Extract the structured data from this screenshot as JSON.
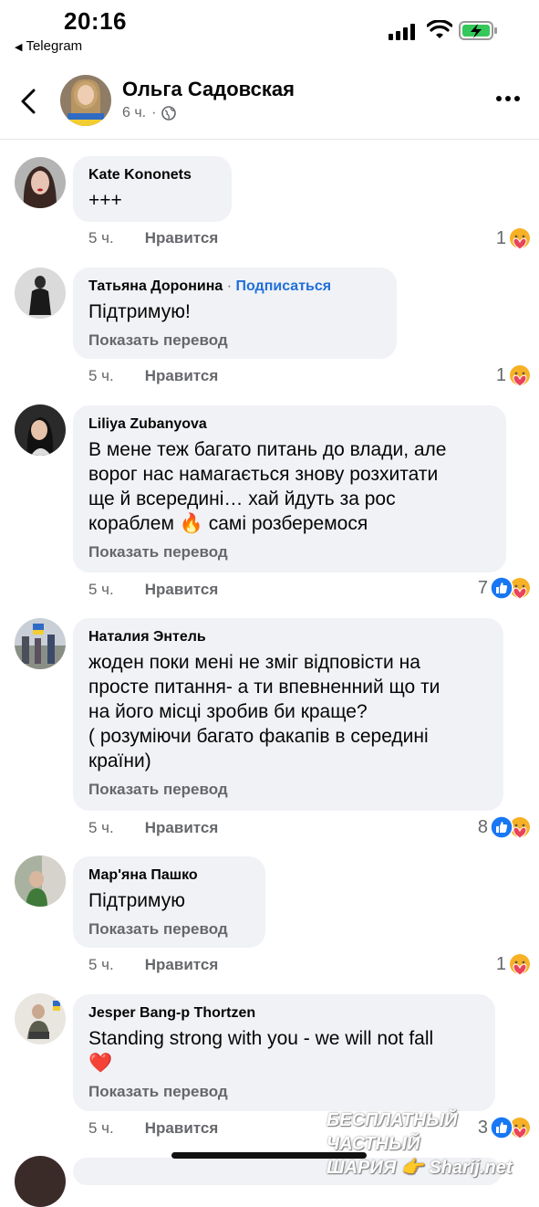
{
  "status_bar": {
    "time": "20:16",
    "back_app": "Telegram"
  },
  "header": {
    "name": "Ольга Садовская",
    "time": "6 ч.",
    "separator": "·"
  },
  "comments": [
    {
      "author": "Kate  Kononets",
      "text": "+++",
      "translate": "",
      "time": "5 ч.",
      "like": "Нравится",
      "count": "1",
      "reactions": [
        "care"
      ]
    },
    {
      "author": "Татьяна Доронина",
      "follow_sep": " · ",
      "follow": "Подписаться",
      "text": "Підтримую!",
      "translate": "Показать перевод",
      "time": "5 ч.",
      "like": "Нравится",
      "count": "1",
      "reactions": [
        "care"
      ]
    },
    {
      "author": "Liliya Zubanyova",
      "text_lines": [
        "В мене теж багато питань до влади, але",
        "ворог нас намагається знову розхитати",
        "ще й всередині… хай йдуть за рос",
        "кораблем"
      ],
      "text_tail": " самі розберемося",
      "emoji": "🔥",
      "translate": "Показать перевод",
      "time": "5 ч.",
      "like": "Нравится",
      "count": "7",
      "reactions": [
        "like",
        "care"
      ]
    },
    {
      "author": "Наталия Энтель",
      "text_lines": [
        "жоден поки мені не зміг відповісти на",
        "просте питання- а ти впевненний що ти",
        "на його місці зробив би краще?",
        "( розуміючи багато факапів в середині",
        "країни)"
      ],
      "translate": "Показать перевод",
      "time": "5 ч.",
      "like": "Нравится",
      "count": "8",
      "reactions": [
        "like",
        "care"
      ]
    },
    {
      "author": "Мар'яна Пашко",
      "text": "Підтримую",
      "translate": "Показать перевод",
      "time": "5 ч.",
      "like": "Нравится",
      "count": "1",
      "reactions": [
        "care"
      ]
    },
    {
      "author": "Jesper Bang-p Thortzen",
      "text": "Standing strong with you - we will not fall",
      "emoji": "❤️",
      "translate": "Показать перевод",
      "time": "5 ч.",
      "like": "Нравится",
      "count": "3",
      "reactions": [
        "like",
        "care"
      ]
    }
  ],
  "watermark": {
    "line1": "БЕСПЛАТНЫЙ ЧАСТНЫЙ",
    "line2": "ШАРИЯ 👉 Sharij.net"
  }
}
